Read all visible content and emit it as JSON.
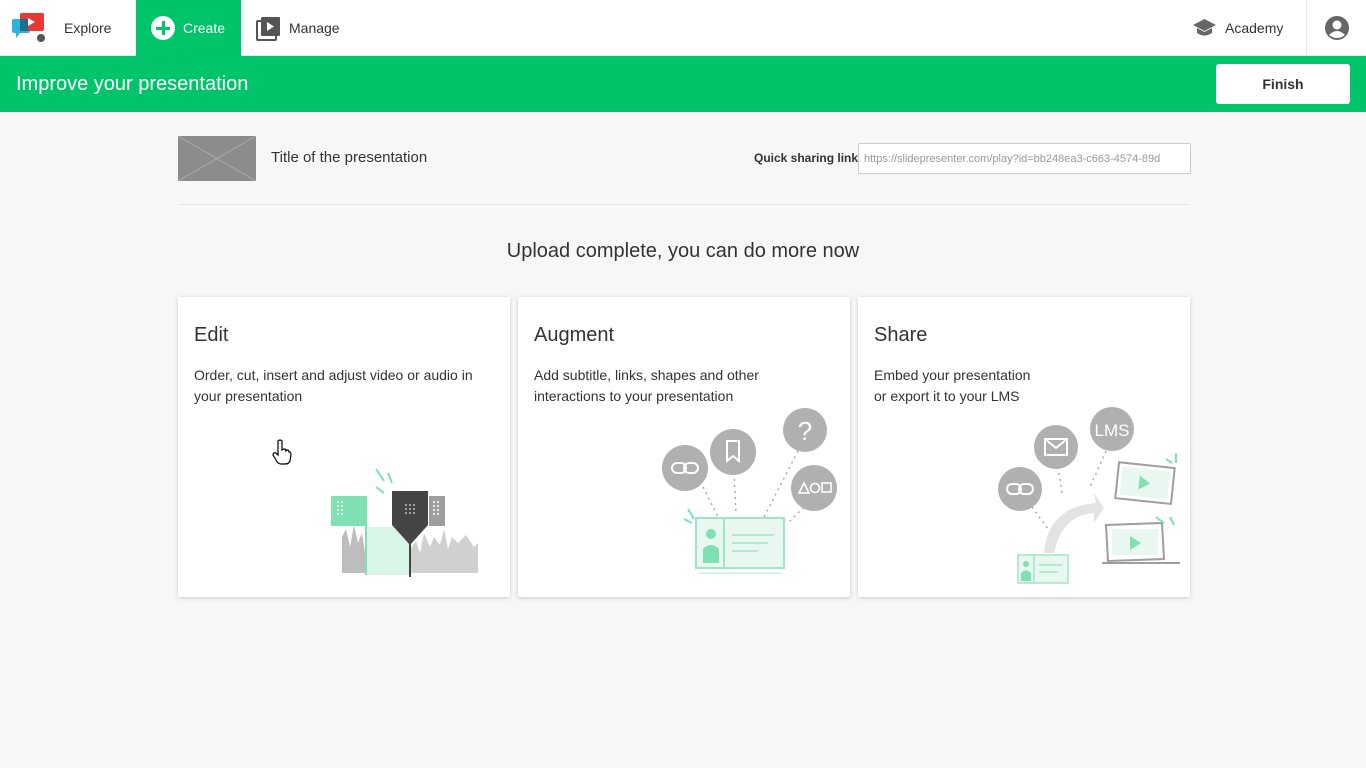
{
  "nav": {
    "explore": "Explore",
    "create": "Create",
    "manage": "Manage",
    "academy": "Academy"
  },
  "banner": {
    "title": "Improve your presentation",
    "finish": "Finish"
  },
  "presentation": {
    "title": "Title of the presentation",
    "share_label": "Quick sharing link",
    "share_link": "https://slidepresenter.com/play?id=bb248ea3-c663-4574-89d"
  },
  "upload_message": "Upload complete, you can do more now",
  "cards": [
    {
      "title": "Edit",
      "description": "Order, cut, insert and adjust video or audio in\nyour presentation"
    },
    {
      "title": "Augment",
      "description": "Add subtitle, links, shapes and other\ninteractions to your presentation"
    },
    {
      "title": "Share",
      "description": "Embed your presentation\nor export it to your LMS",
      "lms_badge": "LMS"
    }
  ],
  "colors": {
    "accent": "#00c46a",
    "mint": "#7fe0b3",
    "grey": "#9e9e9e"
  },
  "icons": [
    "app-logo-icon",
    "plus-icon",
    "video-library-icon",
    "graduation-cap-icon",
    "account-icon",
    "link-icon",
    "bookmark-icon",
    "question-icon",
    "shapes-icon",
    "mail-icon",
    "play-icon"
  ]
}
